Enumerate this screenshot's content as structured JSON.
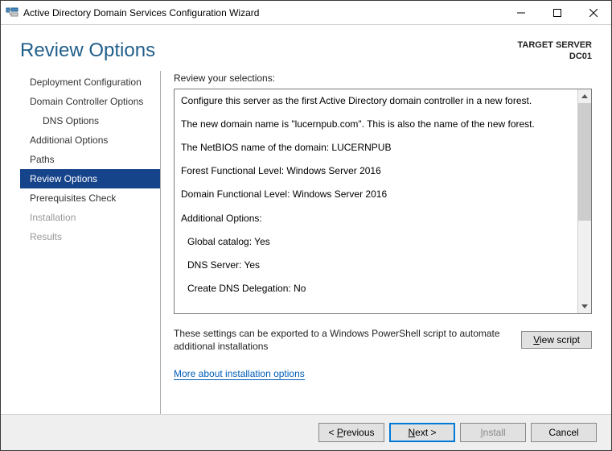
{
  "window": {
    "title": "Active Directory Domain Services Configuration Wizard"
  },
  "header": {
    "title": "Review Options",
    "server_label": "TARGET SERVER",
    "server_name": "DC01"
  },
  "sidebar": {
    "items": [
      {
        "label": "Deployment Configuration",
        "indent": false,
        "selected": false,
        "disabled": false
      },
      {
        "label": "Domain Controller Options",
        "indent": false,
        "selected": false,
        "disabled": false
      },
      {
        "label": "DNS Options",
        "indent": true,
        "selected": false,
        "disabled": false
      },
      {
        "label": "Additional Options",
        "indent": false,
        "selected": false,
        "disabled": false
      },
      {
        "label": "Paths",
        "indent": false,
        "selected": false,
        "disabled": false
      },
      {
        "label": "Review Options",
        "indent": false,
        "selected": true,
        "disabled": false
      },
      {
        "label": "Prerequisites Check",
        "indent": false,
        "selected": false,
        "disabled": false
      },
      {
        "label": "Installation",
        "indent": false,
        "selected": false,
        "disabled": true
      },
      {
        "label": "Results",
        "indent": false,
        "selected": false,
        "disabled": true
      }
    ]
  },
  "main": {
    "review_label": "Review your selections:",
    "lines": [
      "Configure this server as the first Active Directory domain controller in a new forest.",
      "The new domain name is \"lucernpub.com\". This is also the name of the new forest.",
      "The NetBIOS name of the domain: LUCERNPUB",
      "Forest Functional Level: Windows Server 2016",
      "Domain Functional Level: Windows Server 2016",
      "Additional Options:"
    ],
    "sub_lines": [
      "Global catalog: Yes",
      "DNS Server: Yes",
      "Create DNS Delegation: No"
    ],
    "export_text": "These settings can be exported to a Windows PowerShell script to automate additional installations",
    "view_script_label": "View script",
    "more_link": "More about installation options"
  },
  "footer": {
    "previous": "Previous",
    "next": "Next",
    "install": "Install",
    "cancel": "Cancel"
  }
}
